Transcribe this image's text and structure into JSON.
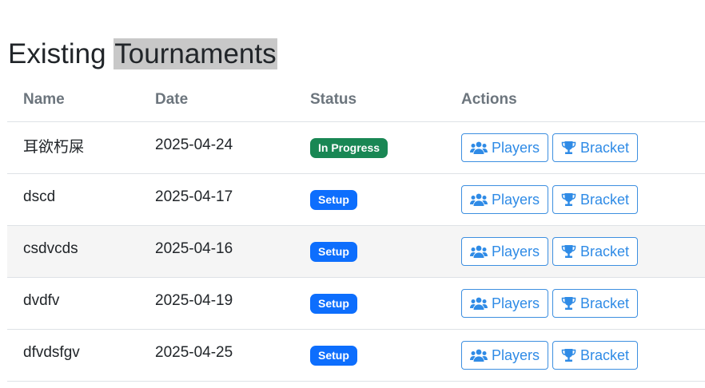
{
  "page": {
    "title_prefix": "Existing ",
    "title_highlight": "Tournaments"
  },
  "table": {
    "headers": {
      "name": "Name",
      "date": "Date",
      "status": "Status",
      "actions": "Actions"
    },
    "buttons": {
      "players": "Players",
      "bracket": "Bracket"
    },
    "rows": [
      {
        "name": "耳欲朽屎",
        "date": "2025-04-24",
        "status": "In Progress"
      },
      {
        "name": "dscd",
        "date": "2025-04-17",
        "status": "Setup"
      },
      {
        "name": "csdvcds",
        "date": "2025-04-16",
        "status": "Setup"
      },
      {
        "name": "dvdfv",
        "date": "2025-04-19",
        "status": "Setup"
      },
      {
        "name": "dfvdsfgv",
        "date": "2025-04-25",
        "status": "Setup"
      }
    ]
  },
  "icons": {
    "players": "users-icon",
    "bracket": "trophy-icon"
  },
  "colors": {
    "in_progress": "#198754",
    "setup": "#0d6efd",
    "button": "#2f8be6",
    "highlight": "#c8c8c8"
  }
}
